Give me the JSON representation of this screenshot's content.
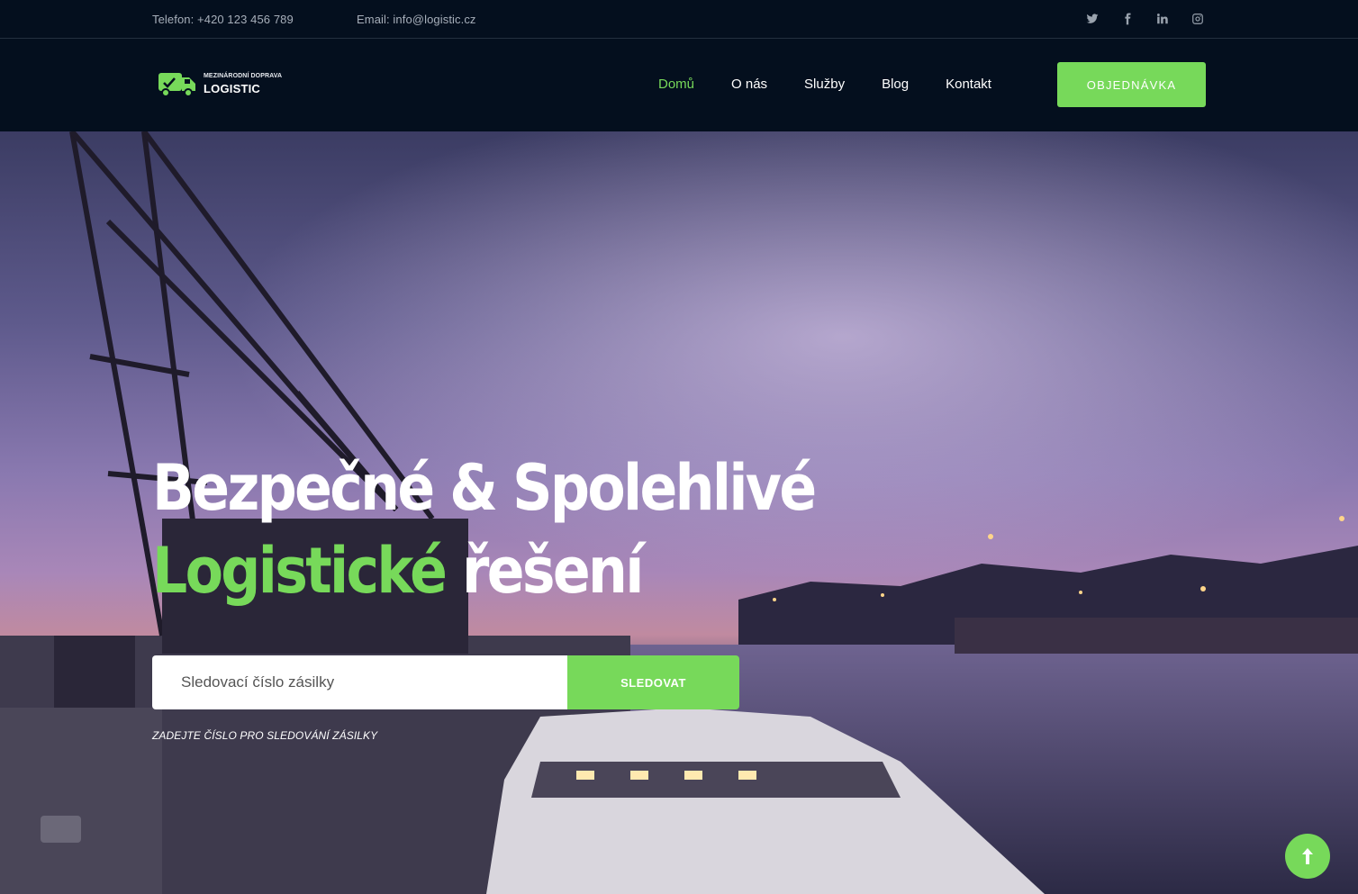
{
  "topbar": {
    "phone": "Telefon: +420 123 456 789",
    "email": "Email: info@logistic.cz",
    "socials": [
      "twitter-icon",
      "facebook-icon",
      "linkedin-icon",
      "instagram-icon"
    ]
  },
  "logo": {
    "subtitle": "MEZINÁRODNÍ DOPRAVA",
    "title": "LOGISTIC",
    "icon": "truck-icon"
  },
  "nav": {
    "items": [
      {
        "label": "Domů",
        "active": true
      },
      {
        "label": "O nás",
        "active": false
      },
      {
        "label": "Služby",
        "active": false
      },
      {
        "label": "Blog",
        "active": false
      },
      {
        "label": "Kontakt",
        "active": false
      }
    ],
    "cta": "OBJEDNÁVKA"
  },
  "hero": {
    "line1": "Bezpečné & Spolehlivé",
    "line2_green": "Logistické",
    "line2_white": " řešení",
    "search_placeholder": "Sledovací číslo zásilky",
    "search_button": "SLEDOVAT",
    "hint": "ZADEJTE ČÍSLO PRO SLEDOVÁNÍ ZÁSILKY"
  },
  "scroll_top": {
    "icon": "arrow-up-icon"
  },
  "colors": {
    "accent": "#77d95a",
    "navy": "#040f1e",
    "text_muted": "#a7afba"
  }
}
